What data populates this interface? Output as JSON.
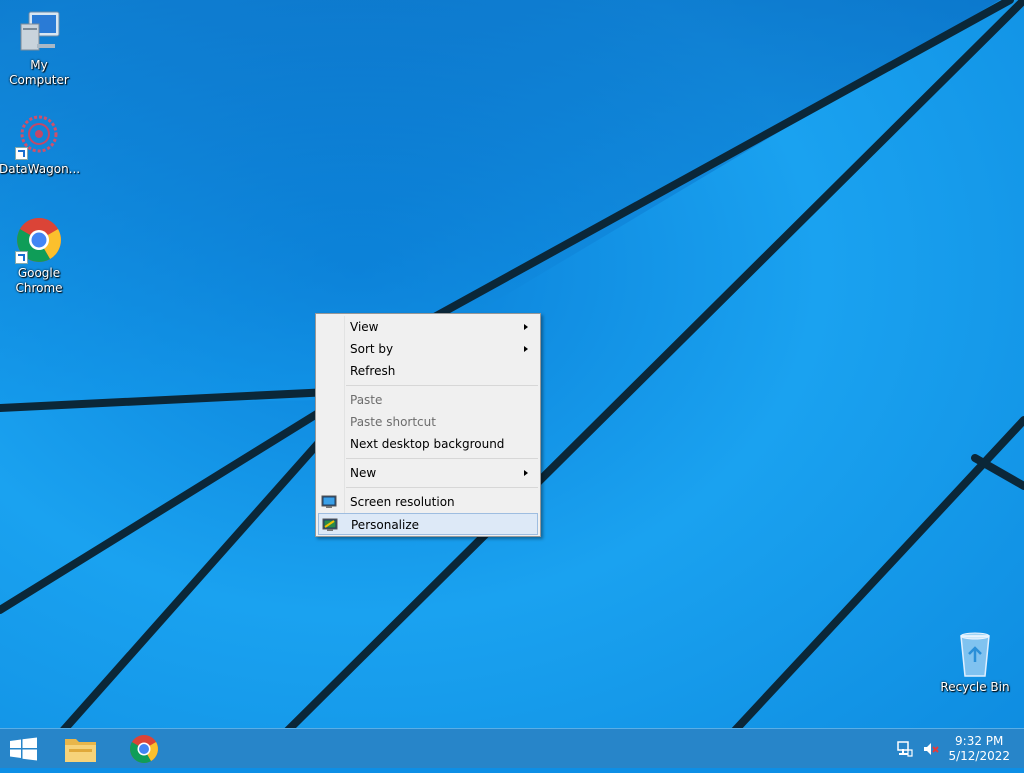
{
  "desktop": {
    "icons": [
      {
        "label": "My Computer",
        "icon": "computer-icon"
      },
      {
        "label": "DataWagon...",
        "icon": "datawagon-icon"
      },
      {
        "label": "Google Chrome",
        "icon": "chrome-icon"
      },
      {
        "label": "Recycle Bin",
        "icon": "recycle-bin-icon"
      }
    ]
  },
  "context_menu": {
    "items": [
      {
        "label": "View",
        "submenu": true,
        "enabled": true
      },
      {
        "label": "Sort by",
        "submenu": true,
        "enabled": true
      },
      {
        "label": "Refresh",
        "enabled": true
      },
      {
        "label": "Paste",
        "enabled": false
      },
      {
        "label": "Paste shortcut",
        "enabled": false
      },
      {
        "label": "Next desktop background",
        "enabled": true
      },
      {
        "label": "New",
        "submenu": true,
        "enabled": true
      },
      {
        "label": "Screen resolution",
        "enabled": true,
        "icon": "display-icon"
      },
      {
        "label": "Personalize",
        "enabled": true,
        "icon": "personalize-icon",
        "highlighted": true
      }
    ]
  },
  "taskbar": {
    "pinned": [
      "start-button",
      "file-explorer-icon",
      "chrome-icon"
    ],
    "tray_icons": [
      "network-icon",
      "volume-muted-icon"
    ],
    "clock": {
      "time": "9:32 PM",
      "date": "5/12/2022"
    }
  },
  "colors": {
    "wallpaper": "#0d8fe6",
    "taskbar": "#2785c9",
    "menu_highlight": "#dde9f7"
  }
}
